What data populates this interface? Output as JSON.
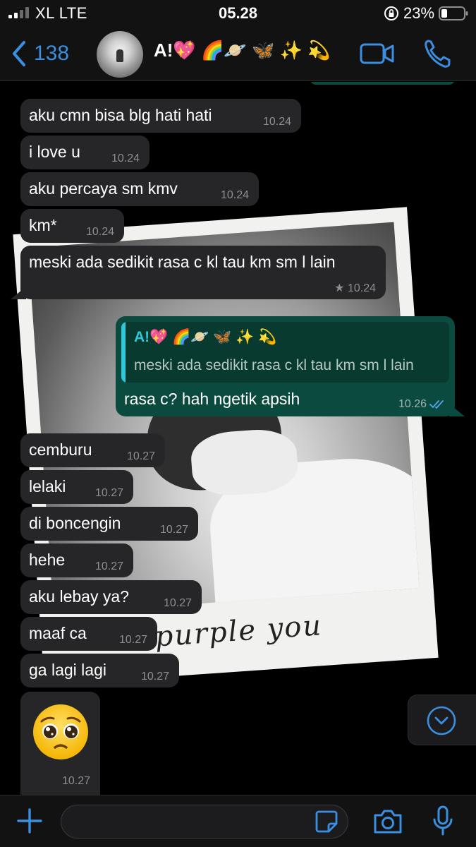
{
  "status_bar": {
    "carrier": "XL  LTE",
    "time": "05.28",
    "battery_percent": "23%",
    "signal_bars": 2,
    "battery_level": 0.23
  },
  "header": {
    "back_count": "138",
    "contact_name": "A!💖 🌈🪐 🦋 ✨ 💫",
    "icons": [
      "chevron-left-icon",
      "video-call-icon",
      "phone-icon"
    ]
  },
  "wallpaper": {
    "caption": "purple you"
  },
  "messages": [
    {
      "text": "aku cmn bisa blg hati hati",
      "time": "10.24",
      "direction": "in"
    },
    {
      "text": "i love u",
      "time": "10.24",
      "direction": "in"
    },
    {
      "text": "aku percaya sm kmv",
      "time": "10.24",
      "direction": "in"
    },
    {
      "text": "km*",
      "time": "10.24",
      "direction": "in"
    },
    {
      "text": "meski ada sedikit rasa c kl tau km sm l lain",
      "time": "★ 10.24",
      "direction": "in"
    },
    {
      "text": "cemburu",
      "time": "10.27",
      "direction": "in"
    },
    {
      "text": "lelaki",
      "time": "10.27",
      "direction": "in"
    },
    {
      "text": "di boncengin",
      "time": "10.27",
      "direction": "in"
    },
    {
      "text": "hehe",
      "time": "10.27",
      "direction": "in"
    },
    {
      "text": "aku lebay ya?",
      "time": "10.27",
      "direction": "in"
    },
    {
      "text": "maaf ca",
      "time": "10.27",
      "direction": "in"
    },
    {
      "text": "ga lagi lagi",
      "time": "10.27",
      "direction": "in"
    }
  ],
  "reply": {
    "quoted_name": "A!💖 🌈🪐 🦋 ✨ 💫",
    "quoted_text": "meski ada sedikit rasa c kl tau km sm l lain",
    "text": "rasa c? hah ngetik apsih",
    "time": "10.26",
    "status": "read"
  },
  "emoji_message": {
    "emoji": "pleading-face",
    "time": "10.27"
  },
  "input_bar": {
    "placeholder": "",
    "icons": [
      "plus-icon",
      "sticker-icon",
      "camera-icon",
      "microphone-icon"
    ]
  },
  "colors": {
    "accent": "#3a8fe0",
    "incoming_bubble": "#262628",
    "outgoing_bubble": "#0b4a3e",
    "quote_accent": "#2ec8d8"
  }
}
